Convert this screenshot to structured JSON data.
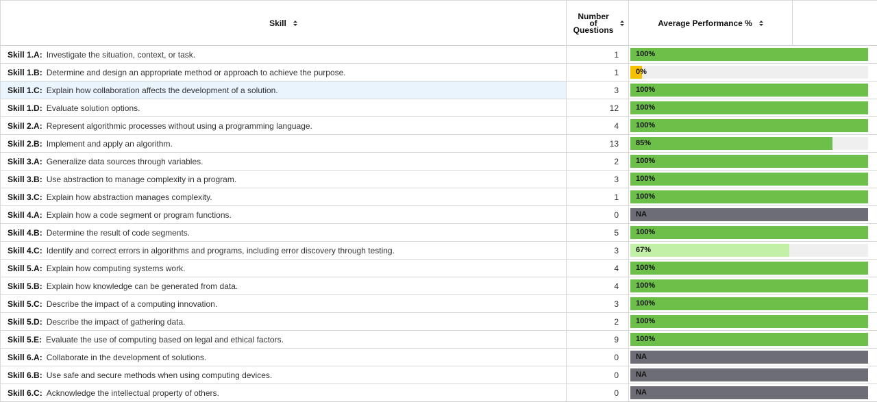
{
  "header": {
    "skill_label": "Skill",
    "num_label_1": "Number",
    "num_label_2": "of",
    "num_label_3": "Questions",
    "perf_label": "Average Performance %"
  },
  "colors": {
    "full": "#6cc04a",
    "partial_high": "#6cc04a",
    "partial_mid": "#c2f0a6",
    "zero": "#f6c000",
    "na": "#6d6d75",
    "highlight_row": "#eaf4fd"
  },
  "rows": [
    {
      "code": "Skill 1.A:",
      "desc": "Investigate the situation, context, or task.",
      "count": "1",
      "perf_label": "100%",
      "perf": 100
    },
    {
      "code": "Skill 1.B:",
      "desc": "Determine and design an appropriate method or approach to achieve the purpose.",
      "count": "1",
      "perf_label": "0%",
      "perf": 0
    },
    {
      "code": "Skill 1.C:",
      "desc": "Explain how collaboration affects the development of a solution.",
      "count": "3",
      "perf_label": "100%",
      "perf": 100,
      "highlight": true
    },
    {
      "code": "Skill 1.D:",
      "desc": "Evaluate solution options.",
      "count": "12",
      "perf_label": "100%",
      "perf": 100
    },
    {
      "code": "Skill 2.A:",
      "desc": "Represent algorithmic processes without using a programming language.",
      "count": "4",
      "perf_label": "100%",
      "perf": 100
    },
    {
      "code": "Skill 2.B:",
      "desc": "Implement and apply an algorithm.",
      "count": "13",
      "perf_label": "85%",
      "perf": 85
    },
    {
      "code": "Skill 3.A:",
      "desc": "Generalize data sources through variables.",
      "count": "2",
      "perf_label": "100%",
      "perf": 100
    },
    {
      "code": "Skill 3.B:",
      "desc": "Use abstraction to manage complexity in a program.",
      "count": "3",
      "perf_label": "100%",
      "perf": 100
    },
    {
      "code": "Skill 3.C:",
      "desc": "Explain how abstraction manages complexity.",
      "count": "1",
      "perf_label": "100%",
      "perf": 100
    },
    {
      "code": "Skill 4.A:",
      "desc": "Explain how a code segment or program functions.",
      "count": "0",
      "perf_label": "NA",
      "perf": null
    },
    {
      "code": "Skill 4.B:",
      "desc": "Determine the result of code segments.",
      "count": "5",
      "perf_label": "100%",
      "perf": 100
    },
    {
      "code": "Skill 4.C:",
      "desc": "Identify and correct errors in algorithms and programs, including error discovery through testing.",
      "count": "3",
      "perf_label": "67%",
      "perf": 67
    },
    {
      "code": "Skill 5.A:",
      "desc": "Explain how computing systems work.",
      "count": "4",
      "perf_label": "100%",
      "perf": 100
    },
    {
      "code": "Skill 5.B:",
      "desc": "Explain how knowledge can be generated from data.",
      "count": "4",
      "perf_label": "100%",
      "perf": 100
    },
    {
      "code": "Skill 5.C:",
      "desc": "Describe the impact of a computing innovation.",
      "count": "3",
      "perf_label": "100%",
      "perf": 100
    },
    {
      "code": "Skill 5.D:",
      "desc": "Describe the impact of gathering data.",
      "count": "2",
      "perf_label": "100%",
      "perf": 100
    },
    {
      "code": "Skill 5.E:",
      "desc": "Evaluate the use of computing based on legal and ethical factors.",
      "count": "9",
      "perf_label": "100%",
      "perf": 100
    },
    {
      "code": "Skill 6.A:",
      "desc": "Collaborate in the development of solutions.",
      "count": "0",
      "perf_label": "NA",
      "perf": null
    },
    {
      "code": "Skill 6.B:",
      "desc": "Use safe and secure methods when using computing devices.",
      "count": "0",
      "perf_label": "NA",
      "perf": null
    },
    {
      "code": "Skill 6.C:",
      "desc": "Acknowledge the intellectual property of others.",
      "count": "0",
      "perf_label": "NA",
      "perf": null
    }
  ]
}
